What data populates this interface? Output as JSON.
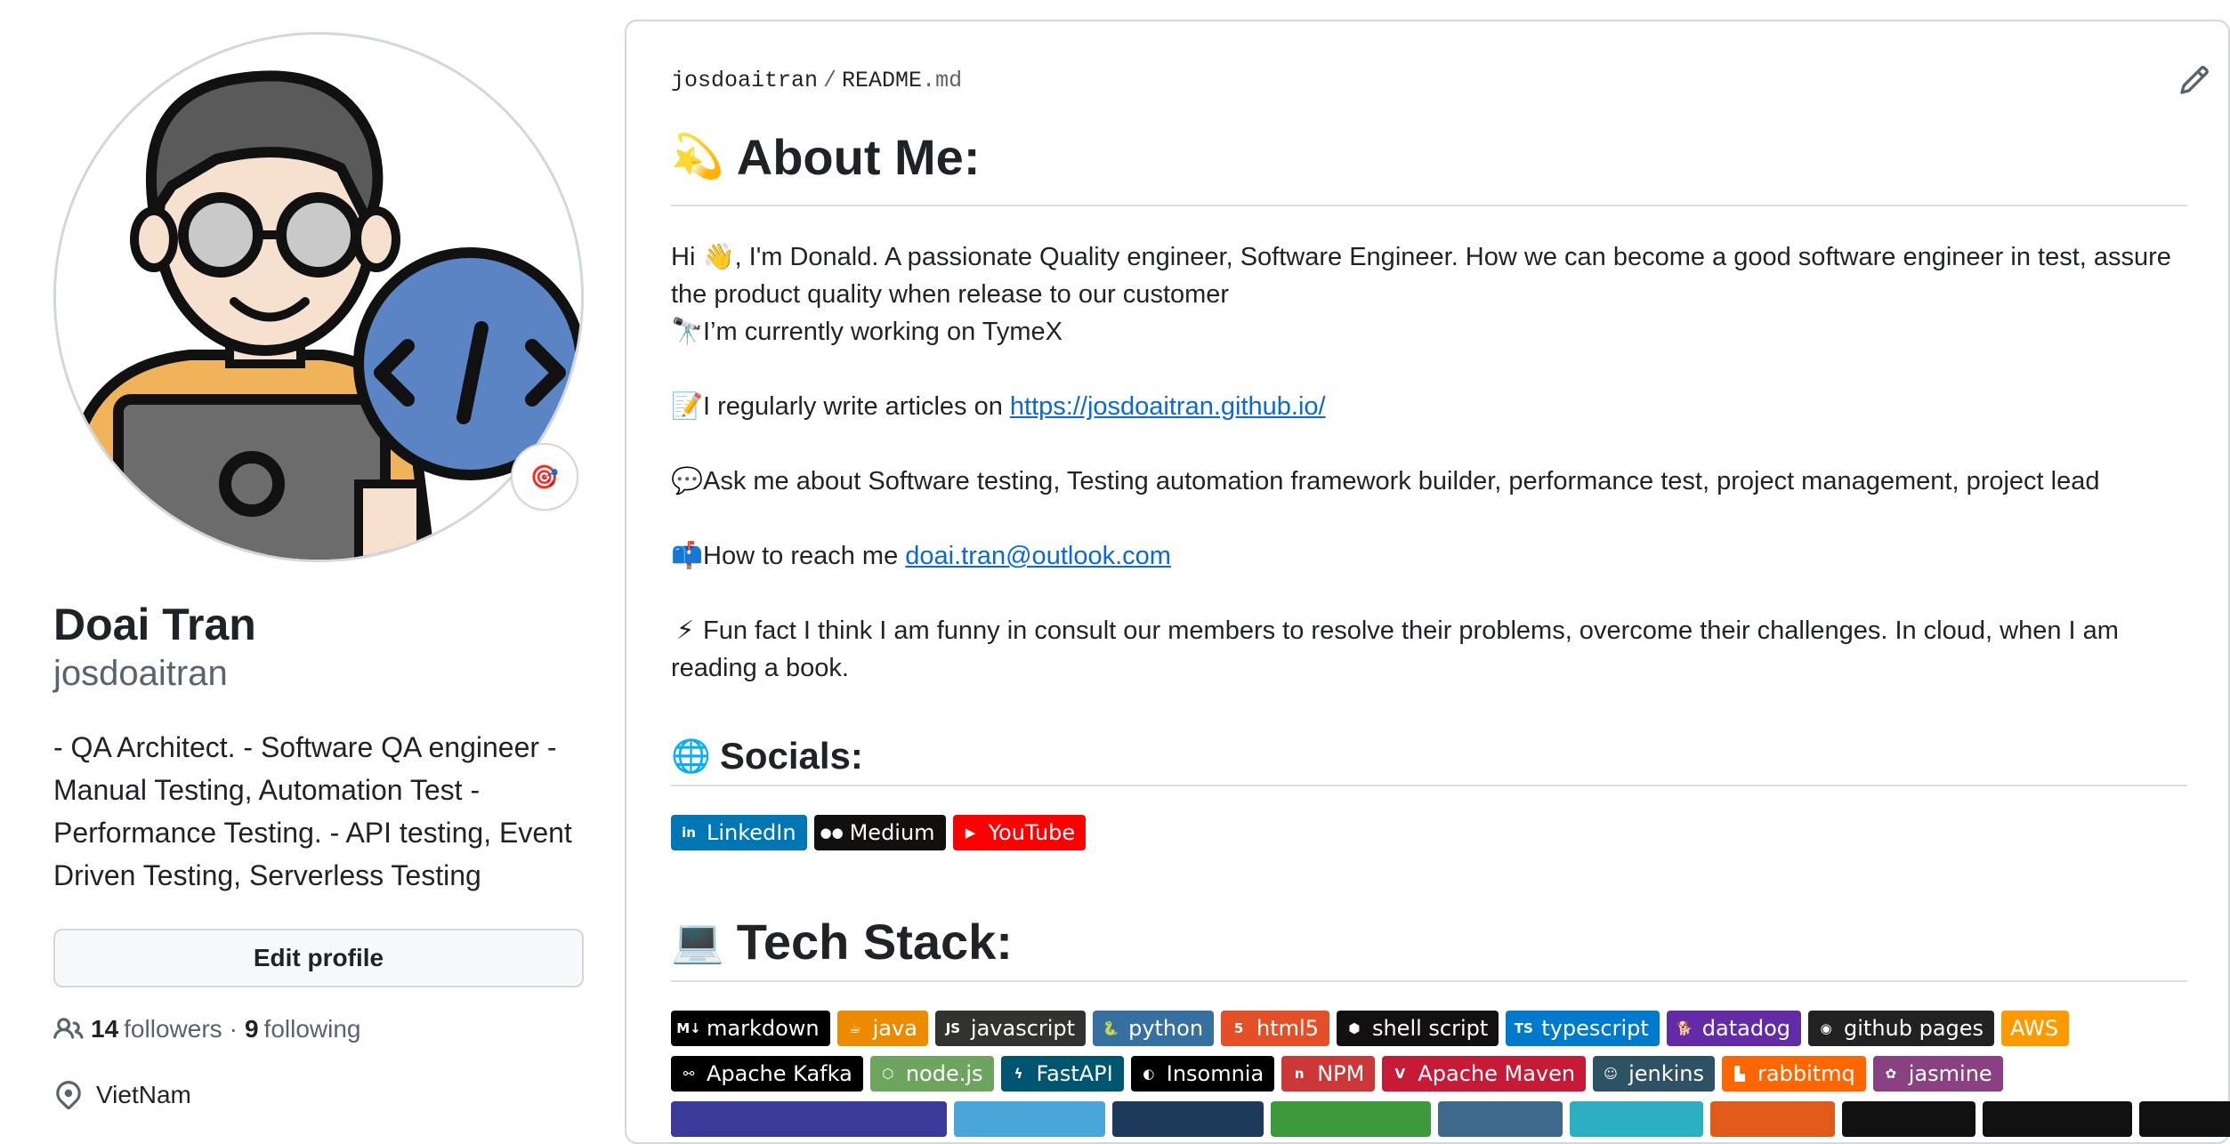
{
  "profile": {
    "name": "Doai Tran",
    "username": "josdoaitran",
    "bio": "- QA Architect. - Software QA engineer - Manual Testing, Automation Test - Performance Testing. - API testing, Event Driven Testing, Serverless Testing",
    "edit_button": "Edit profile",
    "followers_count": "14",
    "followers_label": "followers",
    "separator": "·",
    "following_count": "9",
    "following_label": "following",
    "location": "VietNam",
    "status_emoji": "🎯"
  },
  "readme": {
    "owner": "josdoaitran",
    "slash": "/",
    "file_base": "README",
    "file_ext": ".md",
    "about_emoji": "💫",
    "about_heading": "About Me:",
    "intro_text": "Hi 👋, I'm Donald. A passionate Quality engineer, Software Engineer. How we can become a good software engineer in test, assure the product quality when release to our customer",
    "working_emoji": "🔭",
    "working_text": "I’m currently working on TymeX",
    "articles_emoji": "📝",
    "articles_text": "I regularly write articles on ",
    "articles_link": "https://josdoaitran.github.io/",
    "ask_emoji": "💬",
    "ask_text": "Ask me about Software testing, Testing automation framework builder, performance test, project management, project lead",
    "reach_emoji": "📫",
    "reach_text": "How to reach me ",
    "reach_link": "doai.tran@outlook.com",
    "fun_emoji": "⚡",
    "fun_text": "Fun fact I think I am funny in consult our members to resolve their problems, overcome their challenges. In cloud, when I am reading a book.",
    "socials_emoji": "🌐",
    "socials_heading": "Socials:",
    "socials": [
      {
        "label": "LinkedIn",
        "icon": "in",
        "color": "#0077b5"
      },
      {
        "label": "Medium",
        "icon": "●●",
        "color": "#12100e"
      },
      {
        "label": "YouTube",
        "icon": "▶",
        "color": "#ff0000"
      }
    ],
    "tech_emoji": "💻",
    "tech_heading": "Tech Stack:",
    "tech_row1": [
      {
        "label": "markdown",
        "icon": "M↓",
        "color": "#000000"
      },
      {
        "label": "java",
        "icon": "☕",
        "color": "#ed8b00"
      },
      {
        "label": "javascript",
        "icon": "JS",
        "color": "#323330"
      },
      {
        "label": "python",
        "icon": "🐍",
        "color": "#3670a0"
      },
      {
        "label": "html5",
        "icon": "5",
        "color": "#e34f26"
      },
      {
        "label": "shell script",
        "icon": "⬢",
        "color": "#121011"
      },
      {
        "label": "typescript",
        "icon": "TS",
        "color": "#007acc"
      },
      {
        "label": "datadog",
        "icon": "🐕",
        "color": "#632ca6"
      },
      {
        "label": "github pages",
        "icon": "◉",
        "color": "#222222"
      },
      {
        "label": "AWS",
        "icon": "",
        "color": "#ff9900"
      }
    ],
    "tech_row2": [
      {
        "label": "Apache Kafka",
        "icon": "⚯",
        "color": "#000000"
      },
      {
        "label": "node.js",
        "icon": "⬡",
        "color": "#6da55f"
      },
      {
        "label": "FastAPI",
        "icon": "ϟ",
        "color": "#005571"
      },
      {
        "label": "Insomnia",
        "icon": "◐",
        "color": "#000000"
      },
      {
        "label": "NPM",
        "icon": "n",
        "color": "#cb3837"
      },
      {
        "label": "Apache Maven",
        "icon": "V",
        "color": "#c71a36"
      },
      {
        "label": "jenkins",
        "icon": "☺",
        "color": "#2c5263"
      },
      {
        "label": "rabbitmq",
        "icon": "▙",
        "color": "#ff6600"
      },
      {
        "label": "jasmine",
        "icon": "✿",
        "color": "#8a4182"
      }
    ],
    "tech_row3_colors": [
      "#3a3a9a",
      "#4aa6d8",
      "#1e3a5a",
      "#3c9a3c",
      "#3d6a8a",
      "#2ab0c0",
      "#e05a1a",
      "#111111",
      "#111111",
      "#111111"
    ]
  }
}
